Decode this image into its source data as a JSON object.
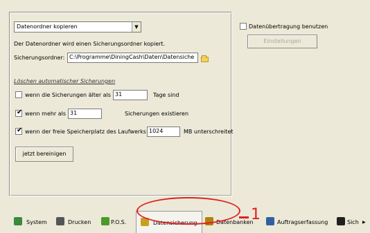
{
  "backup": {
    "mode_select": "Datenordner kopieren",
    "description": "Der Datenordner wird einen Sicherungsordner kopiert.",
    "folder_label": "Sicherungsordner:",
    "folder_path": "C:\\Programme\\DiningCash\\Daten\\Datensiche",
    "auto_delete_title": "Löschen automatischer Sicherungen",
    "older_than": {
      "label": "wenn die Sicherungen älter als",
      "value": "31",
      "suffix": "Tage sind",
      "checked": false
    },
    "more_than": {
      "label": "wenn mehr als",
      "value": "31",
      "suffix": "Sicherungen existieren",
      "checked": true
    },
    "free_space": {
      "label": "wenn der freie Speicherplatz des Laufwerks",
      "value": "1024",
      "suffix": "MB unterschreitet",
      "checked": true
    },
    "cleanup_button": "jetzt bereinigen"
  },
  "transfer": {
    "checkbox_label": "Datenübertragung benutzen",
    "checked": false,
    "settings_button": "Einstellungen"
  },
  "tabs": [
    {
      "label": "System",
      "icon": "system-icon",
      "color": "#3a8a3a"
    },
    {
      "label": "Drucken",
      "icon": "printer-icon",
      "color": "#555555"
    },
    {
      "label": "P.O.S.",
      "icon": "pos-icon",
      "color": "#4a9a2a"
    },
    {
      "label": "Datensicherung",
      "icon": "backup-icon",
      "color": "#c8a020",
      "active": true
    },
    {
      "label": "Datenbanken",
      "icon": "database-icon",
      "color": "#b08010"
    },
    {
      "label": "Auftragserfassung",
      "icon": "order-icon",
      "color": "#3060a0"
    },
    {
      "label": "Sich",
      "icon": "security-icon",
      "color": "#202020"
    }
  ],
  "annotation": {
    "number": "1",
    "color": "#e02020"
  }
}
